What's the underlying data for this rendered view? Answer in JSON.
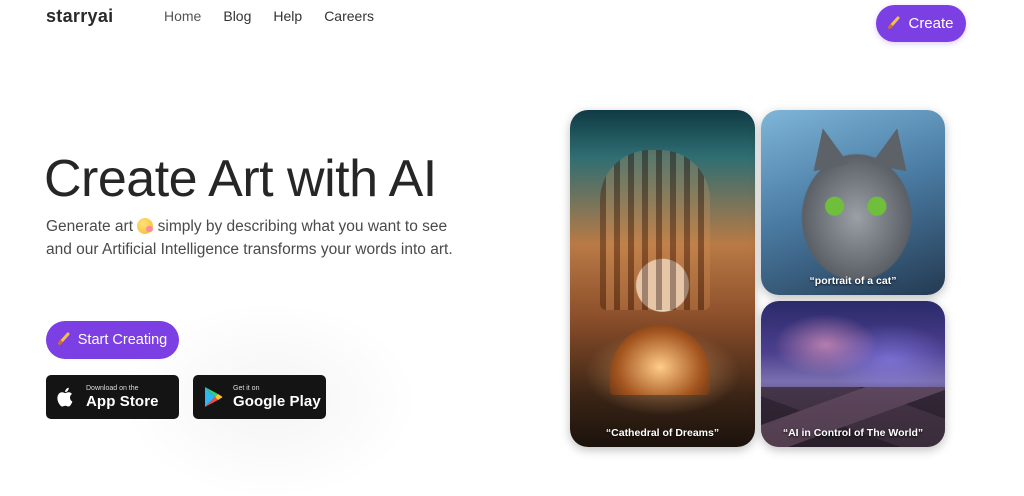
{
  "brand": {
    "logo": "starryai"
  },
  "nav": {
    "items": [
      "Home",
      "Blog",
      "Help",
      "Careers"
    ]
  },
  "header": {
    "create_label": "Create"
  },
  "hero": {
    "title": "Create Art with AI",
    "subtitle_before_emoji": "Generate art",
    "subtitle_after_emoji": " simply by describing what you want to see and our Artificial Intelligence transforms your words into art.",
    "start_label": "Start Creating"
  },
  "stores": {
    "apple": {
      "small": "Download on the",
      "big": "App Store"
    },
    "google": {
      "small": "Get it on",
      "big": "Google Play"
    }
  },
  "gallery": [
    {
      "caption": "“Cathedral of Dreams”"
    },
    {
      "caption": "“portrait of a cat”"
    },
    {
      "caption": "“AI in Control of The World”"
    }
  ],
  "colors": {
    "accent": "#7b3fe4",
    "store_bg": "#141414"
  },
  "icons": {
    "create": "paintbrush-icon",
    "apple": "apple-icon",
    "google_play": "google-play-icon"
  }
}
